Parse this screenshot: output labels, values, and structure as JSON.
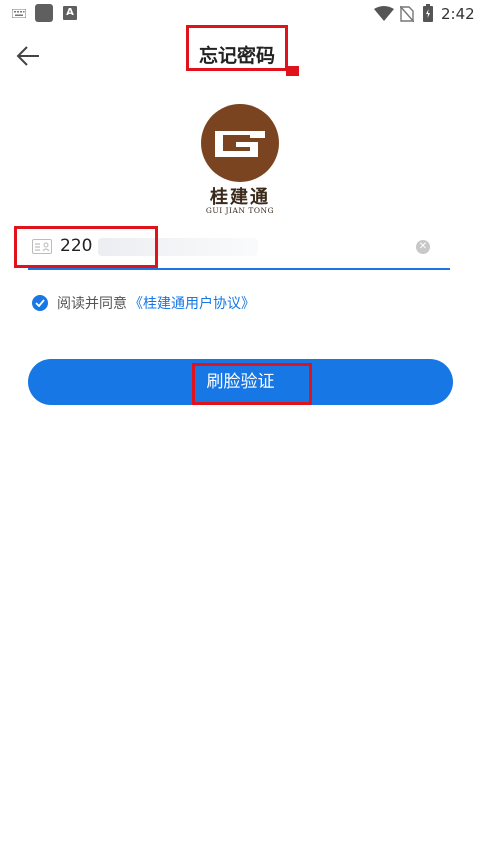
{
  "status_bar": {
    "time": "2:42",
    "icons": [
      "keyboard-icon",
      "app-square-icon",
      "a-notification-icon",
      "wifi-icon",
      "no-sim-icon",
      "battery-icon"
    ]
  },
  "header": {
    "title": "忘记密码",
    "back_icon": "arrow-left-icon"
  },
  "logo": {
    "name_cn": "桂建通",
    "name_en": "GUI JIAN TONG"
  },
  "id_input": {
    "value": "220",
    "icon": "id-card-icon",
    "clear_icon": "clear-circle-icon"
  },
  "agreement": {
    "prefix": "阅读并同意",
    "link": "《桂建通用户协议》",
    "checked": true
  },
  "primary_button": {
    "label": "刷脸验证"
  },
  "colors": {
    "accent": "#1677e5",
    "annotation": "#e0121b",
    "logo_brown": "#7a4420"
  }
}
